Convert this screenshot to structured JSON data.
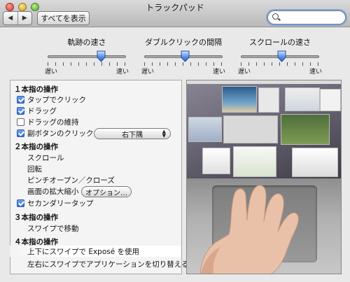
{
  "window": {
    "title": "トラックパッド",
    "back_icon": "◀",
    "forward_icon": "▶",
    "show_all_label": "すべてを表示",
    "search_value": ""
  },
  "sliders": [
    {
      "title": "軌跡の速さ",
      "min_label": "遅い",
      "max_label": "速い",
      "value": 0.68
    },
    {
      "title": "ダブルクリックの間隔",
      "min_label": "遅い",
      "max_label": "速い",
      "value": 0.52
    },
    {
      "title": "スクロールの速さ",
      "min_label": "遅い",
      "max_label": "速い",
      "value": 0.52
    }
  ],
  "one_finger": {
    "header": "１本指の操作",
    "tap_to_click": {
      "label": "タップでクリック",
      "checked": true
    },
    "dragging": {
      "label": "ドラッグ",
      "checked": true
    },
    "drag_lock": {
      "label": "ドラッグの維持",
      "checked": false
    },
    "secondary_click": {
      "label": "副ボタンのクリック",
      "checked": true,
      "popup_value": "右下隅"
    }
  },
  "two_finger": {
    "header": "２本指の操作",
    "scroll": "スクロール",
    "rotate": "回転",
    "pinch": "ピンチオープン／クローズ",
    "zoom": "画面の拡大縮小",
    "options_label": "オプション…",
    "secondary_tap": {
      "label": "セカンダリータップ",
      "checked": true
    }
  },
  "three_finger": {
    "header": "３本指の操作",
    "swipe_nav": "スワイプで移動"
  },
  "four_finger": {
    "header": "４本指の操作",
    "swipe_up_expose": "上下にスワイプで Exposé を使用",
    "swipe_side_apps": "左右にスワイプでアプリケーションを切り替える"
  },
  "colors": {
    "checkbox_on": "#2f6fd8",
    "search_focus": "#7fa6e0",
    "panel_bg": "#f4f4f4"
  }
}
